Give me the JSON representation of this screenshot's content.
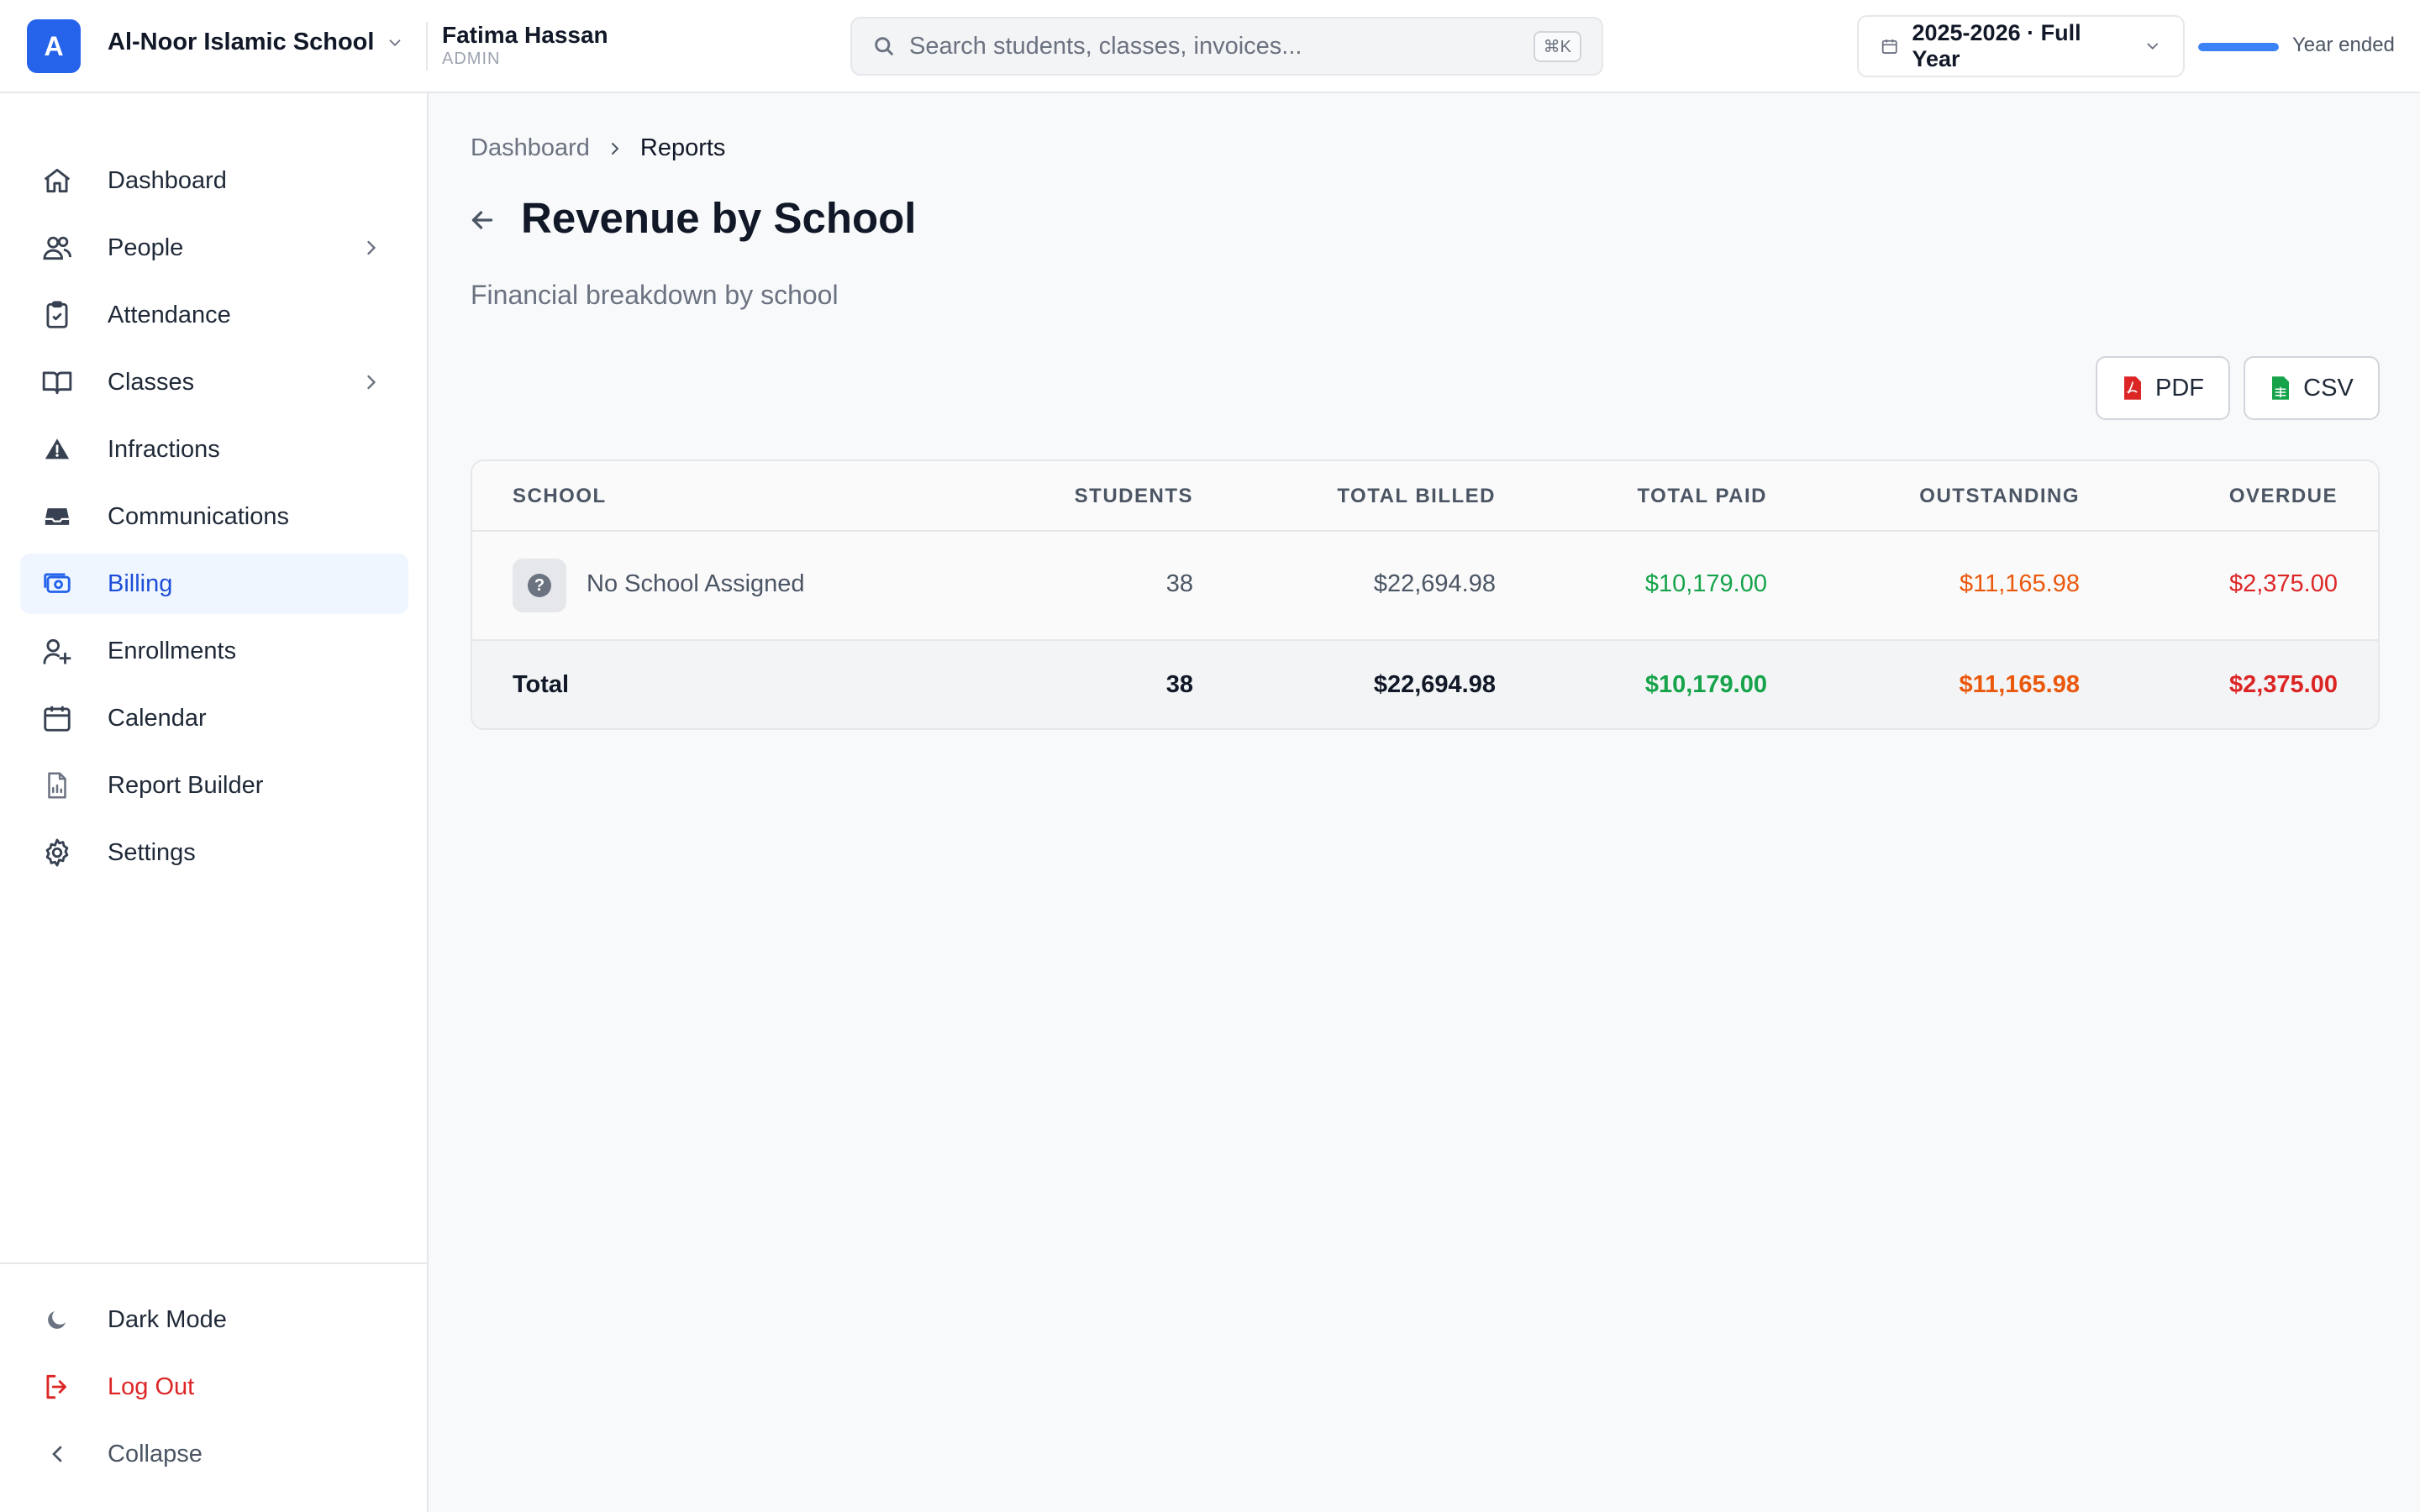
{
  "header": {
    "logo_letter": "A",
    "school_name": "Al-Noor Islamic School",
    "user_name": "Fatima Hassan",
    "user_role": "ADMIN",
    "search_placeholder": "Search students, classes, invoices...",
    "search_shortcut": "⌘K",
    "year_label": "2025-2026 · Full Year",
    "year_progress": 1.0,
    "year_status": "Year ended"
  },
  "sidebar": {
    "items": [
      {
        "label": "Dashboard",
        "icon": "home-icon"
      },
      {
        "label": "People",
        "icon": "users-icon",
        "has_children": true
      },
      {
        "label": "Attendance",
        "icon": "clipboard-check-icon"
      },
      {
        "label": "Classes",
        "icon": "book-open-icon",
        "has_children": true
      },
      {
        "label": "Infractions",
        "icon": "warning-icon"
      },
      {
        "label": "Communications",
        "icon": "inbox-icon"
      },
      {
        "label": "Billing",
        "icon": "billing-icon",
        "active": true
      },
      {
        "label": "Enrollments",
        "icon": "user-plus-icon"
      },
      {
        "label": "Calendar",
        "icon": "calendar-icon"
      },
      {
        "label": "Report Builder",
        "icon": "report-icon"
      },
      {
        "label": "Settings",
        "icon": "gear-icon"
      }
    ],
    "footer": [
      {
        "label": "Dark Mode",
        "icon": "moon-icon"
      },
      {
        "label": "Log Out",
        "icon": "logout-icon"
      },
      {
        "label": "Collapse",
        "icon": "chevron-left-icon"
      }
    ]
  },
  "main": {
    "breadcrumb": [
      "Dashboard",
      "Reports"
    ],
    "title": "Revenue by School",
    "subtitle": "Financial breakdown by school",
    "export": {
      "pdf": "PDF",
      "csv": "CSV"
    },
    "table": {
      "columns": [
        "SCHOOL",
        "STUDENTS",
        "TOTAL BILLED",
        "TOTAL PAID",
        "OUTSTANDING",
        "OVERDUE"
      ],
      "rows": [
        {
          "school": "No School Assigned",
          "students": "38",
          "billed": "$22,694.98",
          "paid": "$10,179.00",
          "outstanding": "$11,165.98",
          "overdue": "$2,375.00"
        }
      ],
      "total": {
        "label": "Total",
        "students": "38",
        "billed": "$22,694.98",
        "paid": "$10,179.00",
        "outstanding": "$11,165.98",
        "overdue": "$2,375.00"
      }
    }
  },
  "colors": {
    "accent": "#2563eb",
    "paid": "#16a34a",
    "outstanding": "#ea580c",
    "overdue": "#dc2626"
  }
}
